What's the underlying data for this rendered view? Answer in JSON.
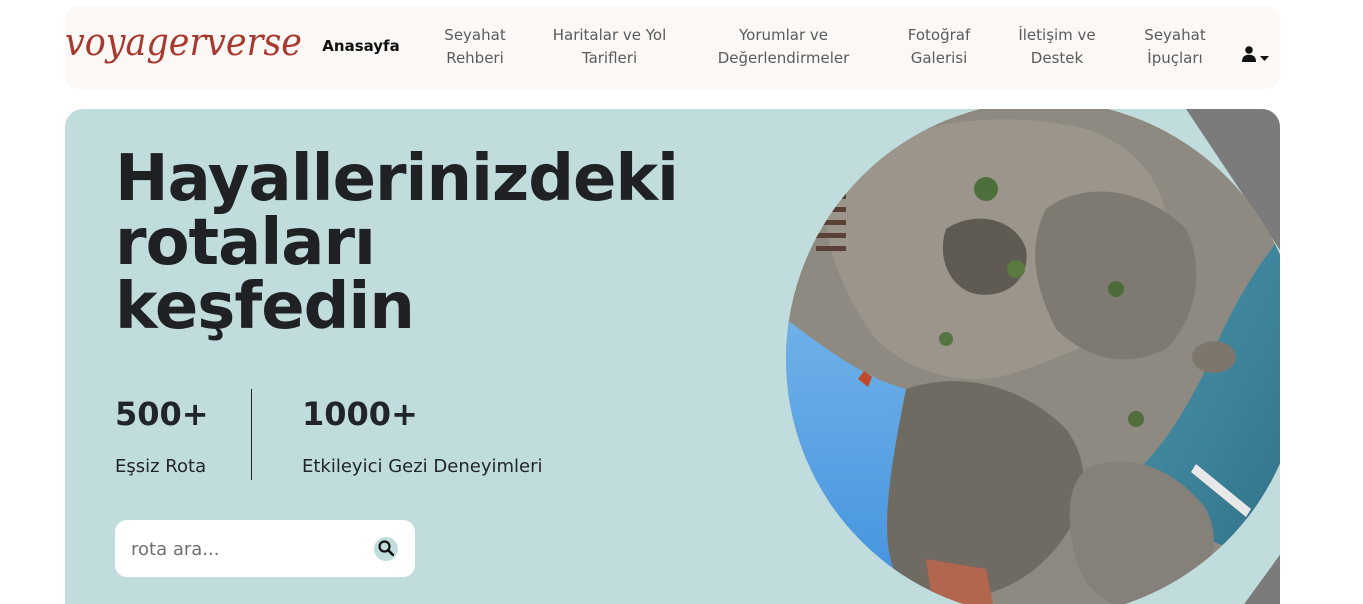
{
  "brand": {
    "logo_text": "voyagerverse"
  },
  "nav": {
    "items": [
      {
        "label": "Anasayfa",
        "active": true
      },
      {
        "label": "Seyahat Rehberi"
      },
      {
        "label": "Haritalar ve Yol Tarifleri"
      },
      {
        "label": "Yorumlar ve Değerlendirmeler"
      },
      {
        "label": "Fotoğraf Galerisi"
      },
      {
        "label": "İletişim ve Destek"
      },
      {
        "label": "Seyahat İpuçları"
      }
    ],
    "user_icon": "user-icon",
    "caret_icon": "caret-down-icon"
  },
  "hero": {
    "title_lines": [
      "Hayallerinizdeki",
      "rotaları",
      "keşfedin"
    ],
    "stats": [
      {
        "value": "500+",
        "label": "Eşsiz Rota"
      },
      {
        "value": "1000+",
        "label": "Etkileyici Gezi Deneyimleri"
      }
    ],
    "search": {
      "placeholder": "rota ara...",
      "icon": "search-icon"
    },
    "image": "coastal-cliffs-photo"
  },
  "colors": {
    "hero_bg": "#c1dcdc",
    "brand": "#a8392e",
    "nav_bg": "#fbf8f6"
  }
}
